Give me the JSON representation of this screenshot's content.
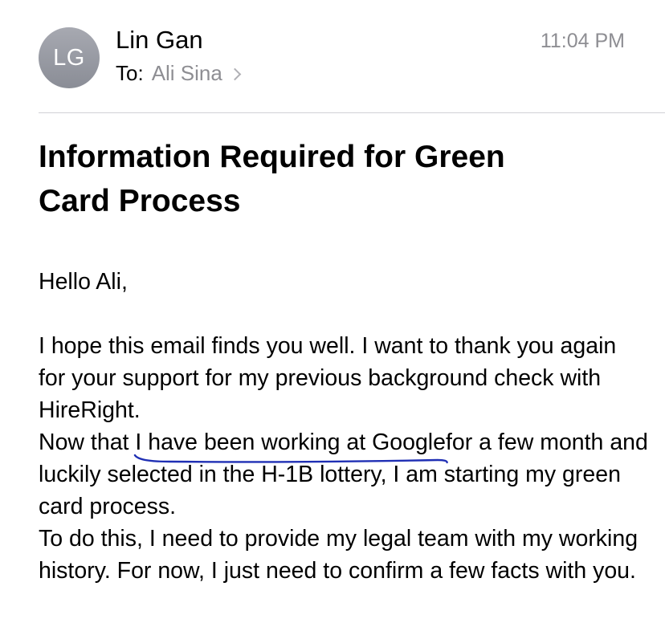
{
  "header": {
    "avatar_initials": "LG",
    "sender_name": "Lin Gan",
    "to_label": "To:",
    "recipient_name": "Ali Sina",
    "time": "11:04 PM"
  },
  "email": {
    "subject_line1": "Information Required for Green",
    "subject_line2": "Card Process",
    "greeting": "Hello Ali,",
    "para1": "I hope this email finds you well. I want to thank you again for your support for my previous background check with HireRight.",
    "para2_before": "Now that ",
    "para2_highlight": "I have been working at Google ",
    "para2_after": "for a few month and luckily selected in the H-1B lottery, I am starting my green card process.",
    "para3": "To do this, I need to provide my legal team with my working history. For now, I just need to confirm a few facts with you."
  },
  "colors": {
    "annotation_ink": "#1f2fb4",
    "secondary_text": "#8e8e93",
    "divider": "#d1d1d6"
  }
}
